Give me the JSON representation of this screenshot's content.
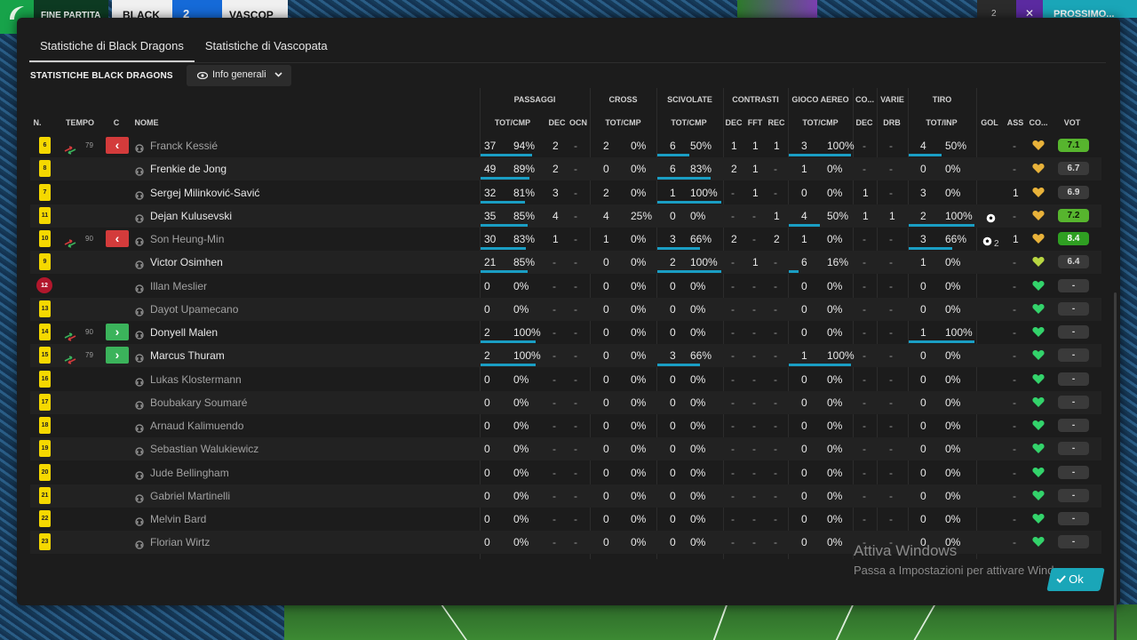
{
  "scoreboard": {
    "status": "FINE PARTITA",
    "home": "BLACK",
    "score": "2 3",
    "away": "VASCOP",
    "count": "2",
    "cta": "PROSSIMO..."
  },
  "tabs": [
    {
      "label": "Statistiche di Black Dragons",
      "active": true
    },
    {
      "label": "Statistiche di Vascopata",
      "active": false
    }
  ],
  "section_title": "STATISTICHE BLACK DRAGONS",
  "view_select": {
    "selected": "Info generali"
  },
  "groups": [
    {
      "key": "passaggi",
      "label": "PASSAGGI"
    },
    {
      "key": "cross",
      "label": "CROSS"
    },
    {
      "key": "scivolate",
      "label": "SCIVOLATE"
    },
    {
      "key": "contrasti",
      "label": "CONTRASTI"
    },
    {
      "key": "aereo",
      "label": "GIOCO AEREO"
    },
    {
      "key": "co",
      "label": "CO..."
    },
    {
      "key": "varie",
      "label": "VARIE"
    },
    {
      "key": "tiro",
      "label": "TIRO"
    }
  ],
  "columns": {
    "n": "N.",
    "tempo": "TEMPO",
    "c": "C",
    "nome": "NOME",
    "pass_tot": "TOT/CMP",
    "pass_dec": "DEC",
    "pass_ocn": "OCN",
    "cross_tot": "TOT/CMP",
    "sciv_tot": "TOT/CMP",
    "con_dec": "DEC",
    "con_fft": "FFT",
    "con_rec": "REC",
    "aer_tot": "TOT/CMP",
    "co_dec": "DEC",
    "var_drb": "DRB",
    "tiro_tot": "TOT/INP",
    "gol": "GOL",
    "ass": "ASS",
    "co": "CO...",
    "vot": "VOT"
  },
  "colors": {
    "accent": "#1a9ec4",
    "sub_out": "#d33b3b",
    "sub_in": "#3bb35b",
    "shirt": "#f5d800",
    "gk": "#b2172c"
  },
  "players": [
    {
      "num": "6",
      "sub": "out",
      "sub_min": "79",
      "name": "Franck Kessié",
      "dim": true,
      "pass": [
        "37",
        "94%"
      ],
      "pass_dec": "2",
      "pass_ocn": "-",
      "cross": [
        "2",
        "0%"
      ],
      "sciv": [
        "6",
        "50%"
      ],
      "con_dec": "1",
      "con_fft": "1",
      "con_rec": "1",
      "aer": [
        "3",
        "100%"
      ],
      "co_dec": "-",
      "drb": "-",
      "tiro": [
        "4",
        "50%"
      ],
      "gol": "",
      "ass": "-",
      "heart": "gold",
      "vote": "7.1",
      "vote_level": "good"
    },
    {
      "num": "8",
      "sub": "",
      "sub_min": "",
      "name": "Frenkie de Jong",
      "dim": false,
      "pass": [
        "49",
        "89%"
      ],
      "pass_dec": "2",
      "pass_ocn": "-",
      "cross": [
        "0",
        "0%"
      ],
      "sciv": [
        "6",
        "83%"
      ],
      "con_dec": "2",
      "con_fft": "1",
      "con_rec": "-",
      "aer": [
        "1",
        "0%"
      ],
      "co_dec": "-",
      "drb": "-",
      "tiro": [
        "0",
        "0%"
      ],
      "gol": "",
      "ass": "-",
      "heart": "gold",
      "vote": "6.7",
      "vote_level": ""
    },
    {
      "num": "7",
      "sub": "",
      "sub_min": "",
      "name": "Sergej Milinković-Savić",
      "dim": false,
      "pass": [
        "32",
        "81%"
      ],
      "pass_dec": "3",
      "pass_ocn": "-",
      "cross": [
        "2",
        "0%"
      ],
      "sciv": [
        "1",
        "100%"
      ],
      "con_dec": "-",
      "con_fft": "1",
      "con_rec": "-",
      "aer": [
        "0",
        "0%"
      ],
      "co_dec": "1",
      "drb": "-",
      "tiro": [
        "3",
        "0%"
      ],
      "gol": "",
      "ass": "1",
      "heart": "gold",
      "vote": "6.9",
      "vote_level": ""
    },
    {
      "num": "11",
      "sub": "",
      "sub_min": "",
      "name": "Dejan Kulusevski",
      "dim": false,
      "pass": [
        "35",
        "85%"
      ],
      "pass_dec": "4",
      "pass_ocn": "-",
      "cross": [
        "4",
        "25%"
      ],
      "sciv": [
        "0",
        "0%"
      ],
      "con_dec": "-",
      "con_fft": "-",
      "con_rec": "1",
      "aer": [
        "4",
        "50%"
      ],
      "co_dec": "1",
      "drb": "1",
      "tiro": [
        "2",
        "100%"
      ],
      "gol": "ball",
      "ass": "-",
      "heart": "gold",
      "vote": "7.2",
      "vote_level": "good"
    },
    {
      "num": "10",
      "sub": "out",
      "sub_min": "90",
      "name": "Son Heung-Min",
      "dim": true,
      "pass": [
        "30",
        "83%"
      ],
      "pass_dec": "1",
      "pass_ocn": "-",
      "cross": [
        "1",
        "0%"
      ],
      "sciv": [
        "3",
        "66%"
      ],
      "con_dec": "2",
      "con_fft": "-",
      "con_rec": "2",
      "aer": [
        "1",
        "0%"
      ],
      "co_dec": "-",
      "drb": "-",
      "tiro": [
        "3",
        "66%"
      ],
      "gol": "ball2",
      "ass": "1",
      "heart": "gold",
      "vote": "8.4",
      "vote_level": "great"
    },
    {
      "num": "9",
      "sub": "",
      "sub_min": "",
      "name": "Victor Osimhen",
      "dim": false,
      "pass": [
        "21",
        "85%"
      ],
      "pass_dec": "-",
      "pass_ocn": "-",
      "cross": [
        "0",
        "0%"
      ],
      "sciv": [
        "2",
        "100%"
      ],
      "con_dec": "-",
      "con_fft": "1",
      "con_rec": "-",
      "aer": [
        "6",
        "16%"
      ],
      "co_dec": "-",
      "drb": "-",
      "tiro": [
        "1",
        "0%"
      ],
      "gol": "",
      "ass": "-",
      "heart": "lime",
      "vote": "6.4",
      "vote_level": ""
    },
    {
      "num": "12",
      "gk": true,
      "sub": "",
      "sub_min": "",
      "name": "Illan Meslier",
      "dim": true,
      "pass": [
        "0",
        "0%"
      ],
      "pass_dec": "-",
      "pass_ocn": "-",
      "cross": [
        "0",
        "0%"
      ],
      "sciv": [
        "0",
        "0%"
      ],
      "con_dec": "-",
      "con_fft": "-",
      "con_rec": "-",
      "aer": [
        "0",
        "0%"
      ],
      "co_dec": "-",
      "drb": "-",
      "tiro": [
        "0",
        "0%"
      ],
      "gol": "",
      "ass": "-",
      "heart": "green",
      "vote": "-",
      "vote_level": ""
    },
    {
      "num": "13",
      "sub": "",
      "sub_min": "",
      "name": "Dayot Upamecano",
      "dim": true,
      "pass": [
        "0",
        "0%"
      ],
      "pass_dec": "-",
      "pass_ocn": "-",
      "cross": [
        "0",
        "0%"
      ],
      "sciv": [
        "0",
        "0%"
      ],
      "con_dec": "-",
      "con_fft": "-",
      "con_rec": "-",
      "aer": [
        "0",
        "0%"
      ],
      "co_dec": "-",
      "drb": "-",
      "tiro": [
        "0",
        "0%"
      ],
      "gol": "",
      "ass": "-",
      "heart": "green",
      "vote": "-",
      "vote_level": ""
    },
    {
      "num": "14",
      "sub": "in",
      "sub_min": "90",
      "name": "Donyell Malen",
      "dim": false,
      "pass": [
        "2",
        "100%"
      ],
      "pass_dec": "-",
      "pass_ocn": "-",
      "cross": [
        "0",
        "0%"
      ],
      "sciv": [
        "0",
        "0%"
      ],
      "con_dec": "-",
      "con_fft": "-",
      "con_rec": "-",
      "aer": [
        "0",
        "0%"
      ],
      "co_dec": "-",
      "drb": "-",
      "tiro": [
        "1",
        "100%"
      ],
      "gol": "",
      "ass": "-",
      "heart": "green",
      "vote": "-",
      "vote_level": ""
    },
    {
      "num": "15",
      "sub": "in",
      "sub_min": "79",
      "name": "Marcus Thuram",
      "dim": false,
      "pass": [
        "2",
        "100%"
      ],
      "pass_dec": "-",
      "pass_ocn": "-",
      "cross": [
        "0",
        "0%"
      ],
      "sciv": [
        "3",
        "66%"
      ],
      "con_dec": "-",
      "con_fft": "-",
      "con_rec": "-",
      "aer": [
        "1",
        "100%"
      ],
      "co_dec": "-",
      "drb": "-",
      "tiro": [
        "0",
        "0%"
      ],
      "gol": "",
      "ass": "-",
      "heart": "green",
      "vote": "-",
      "vote_level": ""
    },
    {
      "num": "16",
      "sub": "",
      "sub_min": "",
      "name": "Lukas Klostermann",
      "dim": true,
      "pass": [
        "0",
        "0%"
      ],
      "pass_dec": "-",
      "pass_ocn": "-",
      "cross": [
        "0",
        "0%"
      ],
      "sciv": [
        "0",
        "0%"
      ],
      "con_dec": "-",
      "con_fft": "-",
      "con_rec": "-",
      "aer": [
        "0",
        "0%"
      ],
      "co_dec": "-",
      "drb": "-",
      "tiro": [
        "0",
        "0%"
      ],
      "gol": "",
      "ass": "-",
      "heart": "green",
      "vote": "-",
      "vote_level": ""
    },
    {
      "num": "17",
      "sub": "",
      "sub_min": "",
      "name": "Boubakary Soumaré",
      "dim": true,
      "pass": [
        "0",
        "0%"
      ],
      "pass_dec": "-",
      "pass_ocn": "-",
      "cross": [
        "0",
        "0%"
      ],
      "sciv": [
        "0",
        "0%"
      ],
      "con_dec": "-",
      "con_fft": "-",
      "con_rec": "-",
      "aer": [
        "0",
        "0%"
      ],
      "co_dec": "-",
      "drb": "-",
      "tiro": [
        "0",
        "0%"
      ],
      "gol": "",
      "ass": "-",
      "heart": "green",
      "vote": "-",
      "vote_level": ""
    },
    {
      "num": "18",
      "sub": "",
      "sub_min": "",
      "name": "Arnaud Kalimuendo",
      "dim": true,
      "pass": [
        "0",
        "0%"
      ],
      "pass_dec": "-",
      "pass_ocn": "-",
      "cross": [
        "0",
        "0%"
      ],
      "sciv": [
        "0",
        "0%"
      ],
      "con_dec": "-",
      "con_fft": "-",
      "con_rec": "-",
      "aer": [
        "0",
        "0%"
      ],
      "co_dec": "-",
      "drb": "-",
      "tiro": [
        "0",
        "0%"
      ],
      "gol": "",
      "ass": "-",
      "heart": "green",
      "vote": "-",
      "vote_level": ""
    },
    {
      "num": "19",
      "sub": "",
      "sub_min": "",
      "name": "Sebastian Walukiewicz",
      "dim": true,
      "pass": [
        "0",
        "0%"
      ],
      "pass_dec": "-",
      "pass_ocn": "-",
      "cross": [
        "0",
        "0%"
      ],
      "sciv": [
        "0",
        "0%"
      ],
      "con_dec": "-",
      "con_fft": "-",
      "con_rec": "-",
      "aer": [
        "0",
        "0%"
      ],
      "co_dec": "-",
      "drb": "-",
      "tiro": [
        "0",
        "0%"
      ],
      "gol": "",
      "ass": "-",
      "heart": "green",
      "vote": "-",
      "vote_level": ""
    },
    {
      "num": "20",
      "sub": "",
      "sub_min": "",
      "name": "Jude Bellingham",
      "dim": true,
      "pass": [
        "0",
        "0%"
      ],
      "pass_dec": "-",
      "pass_ocn": "-",
      "cross": [
        "0",
        "0%"
      ],
      "sciv": [
        "0",
        "0%"
      ],
      "con_dec": "-",
      "con_fft": "-",
      "con_rec": "-",
      "aer": [
        "0",
        "0%"
      ],
      "co_dec": "-",
      "drb": "-",
      "tiro": [
        "0",
        "0%"
      ],
      "gol": "",
      "ass": "-",
      "heart": "green",
      "vote": "-",
      "vote_level": ""
    },
    {
      "num": "21",
      "sub": "",
      "sub_min": "",
      "name": "Gabriel Martinelli",
      "dim": true,
      "pass": [
        "0",
        "0%"
      ],
      "pass_dec": "-",
      "pass_ocn": "-",
      "cross": [
        "0",
        "0%"
      ],
      "sciv": [
        "0",
        "0%"
      ],
      "con_dec": "-",
      "con_fft": "-",
      "con_rec": "-",
      "aer": [
        "0",
        "0%"
      ],
      "co_dec": "-",
      "drb": "-",
      "tiro": [
        "0",
        "0%"
      ],
      "gol": "",
      "ass": "-",
      "heart": "green",
      "vote": "-",
      "vote_level": ""
    },
    {
      "num": "22",
      "sub": "",
      "sub_min": "",
      "name": "Melvin Bard",
      "dim": true,
      "pass": [
        "0",
        "0%"
      ],
      "pass_dec": "-",
      "pass_ocn": "-",
      "cross": [
        "0",
        "0%"
      ],
      "sciv": [
        "0",
        "0%"
      ],
      "con_dec": "-",
      "con_fft": "-",
      "con_rec": "-",
      "aer": [
        "0",
        "0%"
      ],
      "co_dec": "-",
      "drb": "-",
      "tiro": [
        "0",
        "0%"
      ],
      "gol": "",
      "ass": "-",
      "heart": "green",
      "vote": "-",
      "vote_level": ""
    },
    {
      "num": "23",
      "sub": "",
      "sub_min": "",
      "name": "Florian Wirtz",
      "dim": true,
      "pass": [
        "0",
        "0%"
      ],
      "pass_dec": "-",
      "pass_ocn": "-",
      "cross": [
        "0",
        "0%"
      ],
      "sciv": [
        "0",
        "0%"
      ],
      "con_dec": "-",
      "con_fft": "-",
      "con_rec": "-",
      "aer": [
        "0",
        "0%"
      ],
      "co_dec": "-",
      "drb": "-",
      "tiro": [
        "0",
        "0%"
      ],
      "gol": "",
      "ass": "-",
      "heart": "green",
      "vote": "-",
      "vote_level": ""
    }
  ],
  "watermark": {
    "line1": "Attiva Windows",
    "line2": "Passa a Impostazioni per attivare Windows."
  },
  "ok_button": "Ok"
}
